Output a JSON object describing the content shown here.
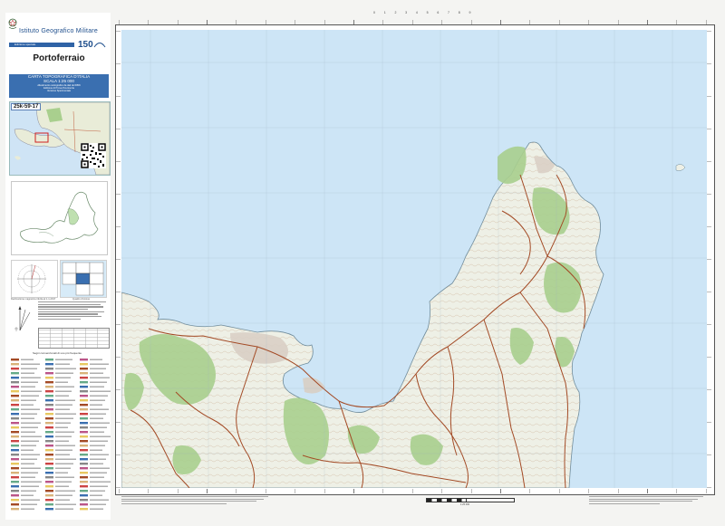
{
  "header": {
    "publisher": "Istituto Geografico Militare",
    "edition_label": "Edizione speciale",
    "anniversary": "150"
  },
  "sheet": {
    "title": "Portoferraio",
    "code": "25k-59-17",
    "carta_line1": "CARTA TOPOGRAFICA D'ITALIA",
    "carta_line2": "SCALA 1:25 000",
    "carta_line3": "Allestimento cartografico da dati del DBN",
    "carta_line4": "Edizione di Prova Provvisoria",
    "carta_line5": "Versione Sperimentale"
  },
  "captions": {
    "declination": "Declinazione magnetica riferita al 1-1-2017",
    "quadro": "Quadro d'unione",
    "legend_title": "Segni convenzionali di uso più frequente",
    "scale": "1:25 000"
  },
  "colors": {
    "sea": "#cde5f6",
    "land": "#eef0e6",
    "vegetation": "#a9cf8e",
    "road": "#a34a25",
    "frame": "#555555",
    "header_blue": "#3a6fb0"
  },
  "icons": {
    "emblem": "italian-republic-emblem-icon",
    "logo": "igm-150-logo-icon",
    "qr": "qr-code-icon",
    "north": "north-arrow-icon"
  }
}
